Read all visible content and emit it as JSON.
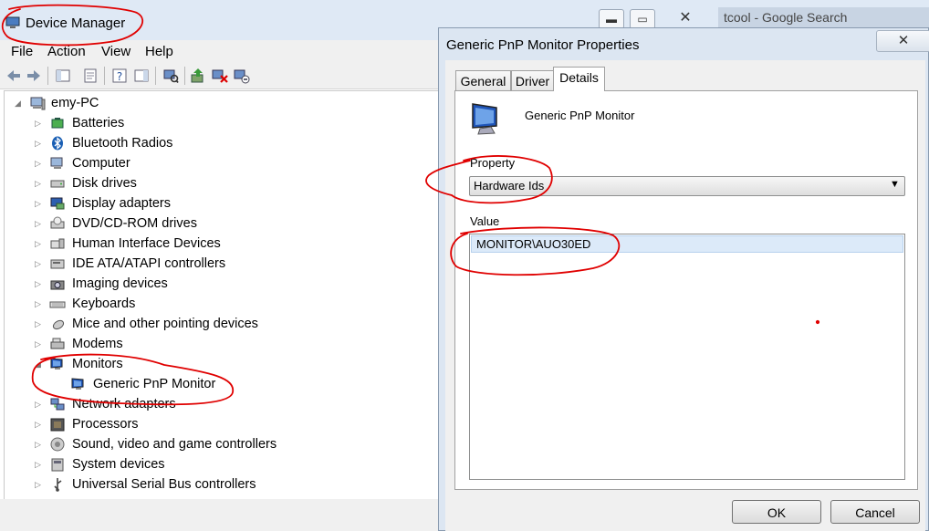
{
  "device_manager": {
    "title": "Device Manager",
    "menu": [
      "File",
      "Action",
      "View",
      "Help"
    ],
    "tree": {
      "root": "emy-PC",
      "categories": [
        {
          "label": "Batteries",
          "icon": "battery-icon",
          "expanded": false
        },
        {
          "label": "Bluetooth Radios",
          "icon": "bluetooth-icon",
          "expanded": false
        },
        {
          "label": "Computer",
          "icon": "computer-icon",
          "expanded": false
        },
        {
          "label": "Disk drives",
          "icon": "disk-drive-icon",
          "expanded": false
        },
        {
          "label": "Display adapters",
          "icon": "display-adapter-icon",
          "expanded": false
        },
        {
          "label": "DVD/CD-ROM drives",
          "icon": "dvd-drive-icon",
          "expanded": false
        },
        {
          "label": "Human Interface Devices",
          "icon": "hid-icon",
          "expanded": false
        },
        {
          "label": "IDE ATA/ATAPI controllers",
          "icon": "ide-controller-icon",
          "expanded": false
        },
        {
          "label": "Imaging devices",
          "icon": "camera-icon",
          "expanded": false
        },
        {
          "label": "Keyboards",
          "icon": "keyboard-icon",
          "expanded": false
        },
        {
          "label": "Mice and other pointing devices",
          "icon": "mouse-icon",
          "expanded": false
        },
        {
          "label": "Modems",
          "icon": "modem-icon",
          "expanded": false
        },
        {
          "label": "Monitors",
          "icon": "monitor-icon",
          "expanded": true
        },
        {
          "label": "Network adapters",
          "icon": "network-adapter-icon",
          "expanded": false
        },
        {
          "label": "Processors",
          "icon": "processor-icon",
          "expanded": false
        },
        {
          "label": "Sound, video and game controllers",
          "icon": "sound-icon",
          "expanded": false
        },
        {
          "label": "System devices",
          "icon": "system-device-icon",
          "expanded": false
        },
        {
          "label": "Universal Serial Bus controllers",
          "icon": "usb-icon",
          "expanded": false
        }
      ],
      "monitor_child": "Generic PnP Monitor"
    }
  },
  "background_window": {
    "title_fragment": "tcool - Google Search"
  },
  "properties_dialog": {
    "title": "Generic PnP Monitor Properties",
    "close_glyph": "✕",
    "tabs": [
      "General",
      "Driver",
      "Details"
    ],
    "active_tab": "Details",
    "device_name": "Generic PnP Monitor",
    "property_label": "Property",
    "property_selected": "Hardware Ids",
    "value_label": "Value",
    "values": [
      "MONITOR\\AUO30ED"
    ],
    "ok_label": "OK",
    "cancel_label": "Cancel"
  },
  "colors": {
    "annotation": "#e00000",
    "title_bar": "#dfe9f5",
    "selection": "#dceaf9"
  }
}
